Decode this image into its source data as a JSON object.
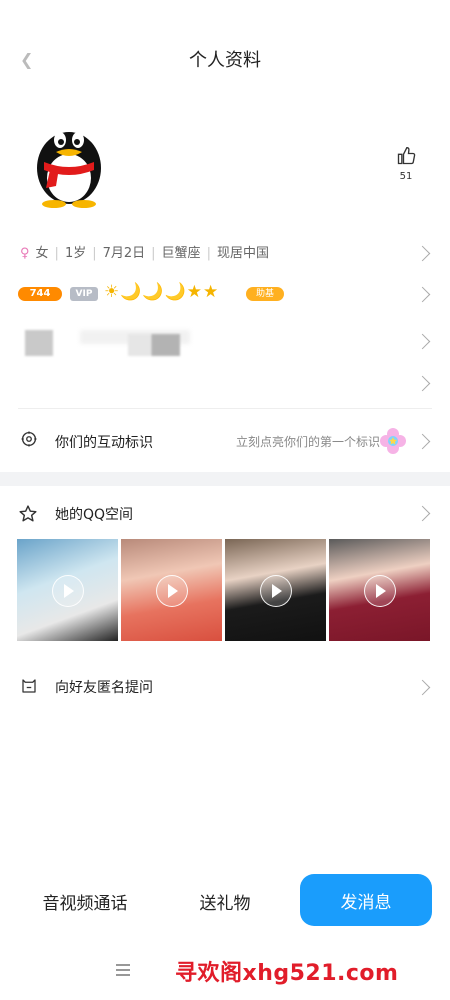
{
  "header": {
    "title": "个人资料",
    "back_icon": "back-icon"
  },
  "profile": {
    "avatar_icon": "qq-penguin-avatar",
    "like_count": "51",
    "gender_symbol": "♀",
    "gender": "女",
    "age": "1岁",
    "birthday": "7月2日",
    "zodiac": "巨蟹座",
    "location": "现居中国"
  },
  "badges": {
    "level": "744",
    "vip": "VIP",
    "level_icons": "☀🌙🌙🌙★★",
    "help": "助基"
  },
  "interaction": {
    "label": "你们的互动标识",
    "hint": "立刻点亮你们的第一个标识"
  },
  "qzone": {
    "label": "她的QQ空间"
  },
  "ask": {
    "label": "向好友匿名提问"
  },
  "actions": {
    "call": "音视频通话",
    "gift": "送礼物",
    "message": "发消息"
  },
  "watermark": "寻欢阁xhg521.com",
  "colors": {
    "accent": "#1a9dfc",
    "watermark": "#e11d2a",
    "level_badge": "#ff8a00"
  }
}
